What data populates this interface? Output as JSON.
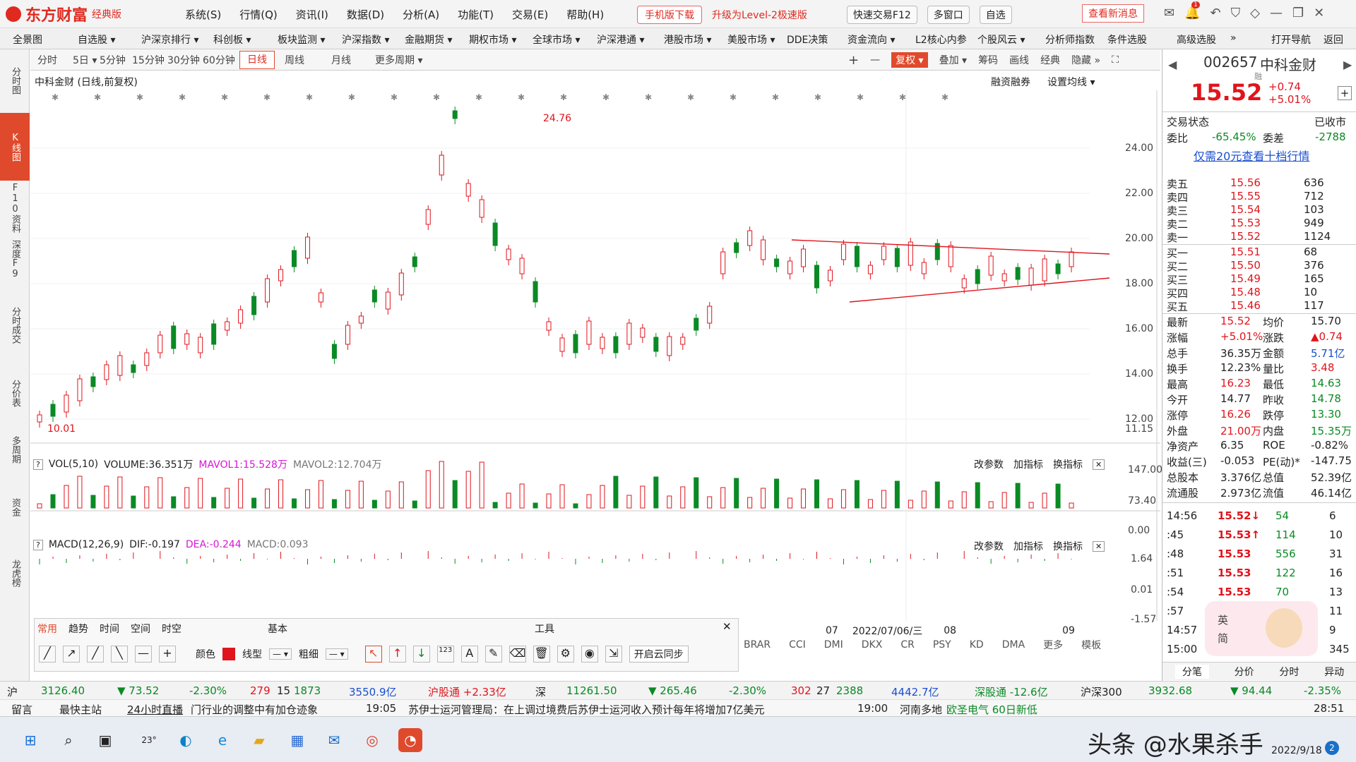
{
  "app": {
    "logo": "东方财富",
    "edition": "经典版"
  },
  "menu": [
    "系统(S)",
    "行情(Q)",
    "资讯(I)",
    "数据(D)",
    "分析(A)",
    "功能(T)",
    "交易(E)",
    "帮助(H)"
  ],
  "title_buttons": {
    "mobile": "手机版下载",
    "level2": "升级为Level-2极速版",
    "quick_trade": "快速交易F12",
    "multi_window": "多窗口",
    "self": "自选",
    "news": "查看新消息",
    "badge": "1"
  },
  "nav": [
    "全景图",
    "自选股 ▾",
    "沪深京排行 ▾",
    "科创板 ▾",
    "板块监测 ▾",
    "沪深指数 ▾",
    "金融期货 ▾",
    "期权市场 ▾",
    "全球市场 ▾",
    "沪深港通 ▾",
    "港股市场 ▾",
    "美股市场 ▾",
    "DDE决策",
    "资金流向 ▾",
    "L2核心内参",
    "个股风云 ▾",
    "分析师指数",
    "条件选股",
    "高级选股",
    "»",
    "打开导航",
    "返回"
  ],
  "left_tabs": [
    "分时图",
    "K线图",
    "F10资料",
    "深度F9",
    "分时成交",
    "分价表",
    "多周期",
    "资金",
    "龙虎榜"
  ],
  "periods": {
    "items": [
      "分时",
      "5日 ▾",
      "5分钟",
      "15分钟",
      "30分钟",
      "60分钟",
      "日线",
      "周线",
      "月线",
      "更多周期 ▾"
    ],
    "active": "日线"
  },
  "chart_tools": {
    "plus": "+",
    "minus": "—",
    "fuquan": "复权 ▾",
    "overlay": "叠加 ▾",
    "chip": "筹码",
    "draw": "画线",
    "classic": "经典",
    "hide": "隐藏 »"
  },
  "kline": {
    "title": "中科金财 (日线,前复权)",
    "margin": "融资融券",
    "ma_setting": "设置均线 ▾",
    "high_label": "24.76",
    "low_label": "10.01",
    "yticks": [
      "24.00",
      "22.00",
      "20.00",
      "18.00",
      "16.00",
      "14.00",
      "12.00",
      "11.15"
    ]
  },
  "vol": {
    "label": "VOL(5,10)",
    "volume": "VOLUME:36.351万",
    "mavol1": "MAVOL1:15.528万",
    "mavol2": "MAVOL2:12.704万",
    "yticks": [
      "147.00",
      "73.40",
      "0.00"
    ]
  },
  "macd": {
    "label": "MACD(12,26,9)",
    "dif": "DIF:-0.197",
    "dea": "DEA:-0.244",
    "macd": "MACD:0.093",
    "yticks": [
      "1.64",
      "0.01",
      "-1.57"
    ]
  },
  "sub_buttons": [
    "改参数",
    "加指标",
    "换指标"
  ],
  "xaxis": {
    "labels": [
      "07",
      "2022/07/06/三",
      "08",
      "09"
    ]
  },
  "indicators": [
    "BRAR",
    "CCI",
    "DMI",
    "DKX",
    "CR",
    "PSY",
    "KD",
    "DMA",
    "更多",
    "模板"
  ],
  "drawtool": {
    "tabs": [
      "常用",
      "趋势",
      "时间",
      "空间",
      "时空"
    ],
    "section1": "基本",
    "section2": "工具",
    "color": "颜色",
    "line": "线型",
    "thick": "粗细",
    "cloud": "开启云同步"
  },
  "stock": {
    "code": "002657",
    "name": "中科金财",
    "tag": "融",
    "price": "15.52",
    "change": "+0.74",
    "pct": "+5.01%",
    "state_label": "交易状态",
    "state": "已收市",
    "weibi_l": "委比",
    "weibi": "-65.45%",
    "weicha_l": "委差",
    "weicha": "-2788",
    "promo": "仅需20元查看十档行情",
    "asks": [
      [
        "卖五",
        "15.56",
        "636"
      ],
      [
        "卖四",
        "15.55",
        "712"
      ],
      [
        "卖三",
        "15.54",
        "103"
      ],
      [
        "卖二",
        "15.53",
        "949"
      ],
      [
        "卖一",
        "15.52",
        "1124"
      ]
    ],
    "bids": [
      [
        "买一",
        "15.51",
        "68"
      ],
      [
        "买二",
        "15.50",
        "376"
      ],
      [
        "买三",
        "15.49",
        "165"
      ],
      [
        "买四",
        "15.48",
        "10"
      ],
      [
        "买五",
        "15.46",
        "117"
      ]
    ],
    "stats": [
      [
        "最新",
        "15.52",
        "均价",
        "15.70"
      ],
      [
        "涨幅",
        "+5.01%",
        "涨跌",
        "▲0.74"
      ],
      [
        "总手",
        "36.35万",
        "金额",
        "5.71亿"
      ],
      [
        "换手",
        "12.23%",
        "量比",
        "3.48"
      ],
      [
        "最高",
        "16.23",
        "最低",
        "14.63"
      ],
      [
        "今开",
        "14.77",
        "昨收",
        "14.78"
      ],
      [
        "涨停",
        "16.26",
        "跌停",
        "13.30"
      ],
      [
        "外盘",
        "21.00万",
        "内盘",
        "15.35万"
      ],
      [
        "净资产",
        "6.35",
        "ROE",
        "-0.82%"
      ],
      [
        "收益(三)",
        "-0.053",
        "PE(动)*",
        "-147.75"
      ],
      [
        "总股本",
        "3.376亿",
        "总值",
        "52.39亿"
      ],
      [
        "流通股",
        "2.973亿",
        "流值",
        "46.14亿"
      ]
    ],
    "ticks": [
      [
        "14:56",
        "15.52↓",
        "54",
        "6"
      ],
      [
        ":45",
        "15.53↑",
        "114",
        "10"
      ],
      [
        ":48",
        "15.53",
        "556",
        "31"
      ],
      [
        ":51",
        "15.53",
        "122",
        "16"
      ],
      [
        ":54",
        "15.53",
        "70",
        "13"
      ],
      [
        ":57",
        "",
        "",
        "11"
      ],
      [
        "14:57",
        "",
        "",
        "9"
      ],
      [
        "15:00",
        "",
        "",
        "345"
      ]
    ],
    "bottom_tabs": [
      "分笔",
      "分价",
      "分时",
      "异动"
    ]
  },
  "status": {
    "sh": "沪",
    "sh_idx": "3126.40",
    "sh_chg": "▼ 73.52",
    "sh_pct": "-2.30%",
    "sh_up": "279",
    "sh_flat": "15",
    "sh_down": "1873",
    "sh_amt": "3550.9亿",
    "hgt": "沪股通 +2.33亿",
    "sz": "深",
    "sz_idx": "11261.50",
    "sz_chg": "▼ 265.46",
    "sz_pct": "-2.30%",
    "sz_up": "302",
    "sz_flat": "27",
    "sz_down": "2388",
    "sz_amt": "4442.7亿",
    "sgt": "深股通 -12.6亿",
    "hs300": "沪深300",
    "hs_idx": "3932.68",
    "hs_chg": "▼ 94.44",
    "hs_pct": "-2.35%"
  },
  "news": {
    "msg": "留言",
    "main": "最快主站",
    "live": "24小时直播",
    "n1": "门行业的调整中有加仓迹象",
    "t1": "19:05",
    "n2": "苏伊士运河管理局：在上调过境费后苏伊士运河收入预计每年将增加7亿美元",
    "t2": "19:00",
    "n3": "河南多地",
    "n4": "欧圣电气 60日新低",
    "clock": "28:51"
  },
  "taskbar": {
    "weather": "23°",
    "date": "2022/9/18",
    "watermark": "头条 @水果杀手",
    "badge": "2"
  },
  "colors": {
    "up": "#e0141c",
    "down": "#0a8a24",
    "accent": "#e04a2c",
    "link": "#1a4fd0"
  }
}
